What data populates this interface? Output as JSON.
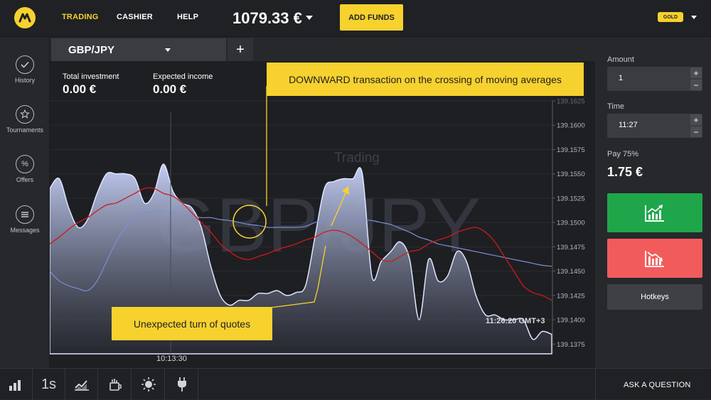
{
  "header": {
    "nav": [
      "TRADING",
      "CASHIER",
      "HELP"
    ],
    "balance": "1079.33 €",
    "add_funds": "ADD FUNDS",
    "badge": "GOLD"
  },
  "sidebar": {
    "items": [
      {
        "label": "History",
        "icon": "check-icon"
      },
      {
        "label": "Tournaments",
        "icon": "trophy-icon"
      },
      {
        "label": "Offers",
        "icon": "percent-icon"
      },
      {
        "label": "Messages",
        "icon": "messages-icon"
      }
    ]
  },
  "tabs": {
    "asset": "GBP/JPY",
    "add": "+"
  },
  "chart": {
    "total_investment_label": "Total investment",
    "total_investment_value": "0.00 €",
    "expected_income_label": "Expected income",
    "expected_income_value": "0.00 €",
    "watermark_small": "Trading",
    "watermark_big": "GBP/JPY",
    "callout_top": "DOWNWARD transaction on the crossing of moving averages",
    "callout_bottom": "Unexpected turn of quotes",
    "time_label": "10:13:30",
    "clock": "11:26:20 GMT+3",
    "colors": {
      "area": "#b9c5ef",
      "ma_fast": "#d0191b",
      "ma_slow": "#7a90d6",
      "callout": "#f7d12e"
    }
  },
  "chart_data": {
    "type": "area",
    "y_ticks": [
      "139.1625",
      "139.1600",
      "139.1575",
      "139.1550",
      "139.1525",
      "139.1500",
      "139.1475",
      "139.1450",
      "139.1425",
      "139.1400",
      "139.1375"
    ],
    "ylim": [
      139.1365,
      139.1625
    ],
    "x_labels": [
      "10:13:30"
    ],
    "series": [
      {
        "values": [
          139.1535,
          139.1545,
          139.1515,
          139.1495,
          139.1503,
          139.153,
          139.155,
          139.155,
          139.155,
          139.1545,
          139.152,
          139.153,
          139.156,
          139.1532,
          139.152,
          139.1515,
          139.1495,
          139.1455,
          139.1425,
          139.1415,
          139.142,
          139.142,
          139.1427,
          139.1427,
          139.143,
          139.1425,
          139.1428,
          139.1435,
          139.1485,
          139.1535,
          139.1542,
          139.1545,
          139.1545,
          139.155,
          139.1445,
          139.146,
          139.147,
          139.148,
          139.1462,
          139.14,
          139.1462,
          139.144,
          139.1445,
          139.147,
          139.146,
          139.1425,
          139.1405,
          139.1405,
          139.14,
          139.14,
          139.14,
          139.138,
          139.1388,
          139.1385
        ]
      },
      {
        "values": [
          139.1478,
          139.1485,
          139.1493,
          139.15,
          139.1505,
          139.1512,
          139.1518,
          139.152,
          139.1525,
          139.153,
          139.1535,
          139.1535,
          139.153,
          139.1527,
          139.152,
          139.151,
          139.15,
          139.149,
          139.1478,
          139.147,
          139.1464,
          139.1462,
          139.1465,
          139.1468,
          139.1472,
          139.1475,
          139.1478,
          139.1482,
          139.1485,
          139.149,
          139.1492,
          139.149,
          139.1485,
          139.1478,
          139.147,
          139.1462,
          139.146,
          139.1465,
          139.147,
          139.1472,
          139.1478,
          139.1482,
          139.1485,
          139.149,
          139.1493,
          139.1495,
          139.149,
          139.148,
          139.1465,
          139.145,
          139.1435,
          139.1428,
          139.1425,
          139.142
        ]
      },
      {
        "values": [
          139.145,
          139.144,
          139.1435,
          139.1432,
          139.143,
          139.144,
          139.146,
          139.148,
          139.1495,
          139.1507,
          139.151,
          139.1512,
          139.1512,
          139.151,
          139.1508,
          139.1507,
          139.1505,
          139.1505,
          139.1503,
          139.1502,
          139.15,
          139.1498,
          139.1497,
          139.1495,
          139.1495,
          139.1495,
          139.1495,
          139.1496,
          139.15,
          139.1503,
          139.1507,
          139.1508,
          139.1505,
          139.1503,
          139.1502,
          139.15,
          139.1498,
          139.1494,
          139.149,
          139.1485,
          139.1482,
          139.1478,
          139.1476,
          139.1474,
          139.1472,
          139.147,
          139.1468,
          139.1466,
          139.1464,
          139.1462,
          139.146,
          139.1458,
          139.1456,
          139.1455
        ]
      }
    ]
  },
  "right_panel": {
    "amount_label": "Amount",
    "amount_value": "1",
    "time_label": "Time",
    "time_value": "11:27",
    "plus": "+",
    "minus": "−",
    "pay_label": "Pay 75%",
    "pay_value": "1.75 €",
    "hotkeys": "Hotkeys",
    "up_color": "#1fa64a",
    "down_color": "#f25b5b"
  },
  "bottom": {
    "interval": "1s",
    "ask": "ASK A QUESTION"
  }
}
